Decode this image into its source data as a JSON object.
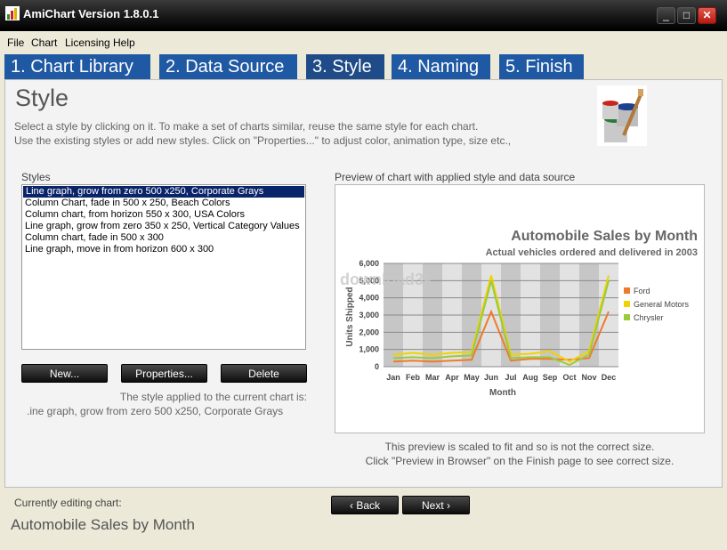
{
  "window": {
    "title": "AmiChart Version 1.8.0.1",
    "minimize": "_",
    "maximize": "□",
    "close": "✕"
  },
  "menu": [
    "File",
    "Chart",
    "Licensing",
    "Help"
  ],
  "tabs": [
    "1. Chart Library",
    "2. Data Source",
    "3. Style",
    "4. Naming",
    "5. Finish"
  ],
  "active_tab": "3. Style",
  "page": {
    "title": "Style",
    "desc1": "Select a style by clicking on it. To make a set of charts similar, reuse the same style for each chart.",
    "desc2": "Use the existing styles or add new styles. Click on \"Properties...\" to adjust color, animation type, size etc.,"
  },
  "styles": {
    "label": "Styles",
    "items": [
      "Line graph, grow from zero 500 x250, Corporate Grays",
      "Column Chart, fade in 500 x 250, Beach Colors",
      "Column chart, from horizon 550 x 300, USA Colors",
      "Line graph, grow from zero 350 x 250, Vertical Category Values",
      "Column chart, fade in 500 x 300",
      "Line graph, move in from horizon 600 x 300"
    ],
    "selected": 0,
    "buttons": {
      "new": "New...",
      "properties": "Properties...",
      "delete": "Delete"
    },
    "applied_label": "The style applied to the current chart is:",
    "applied_value": ".ine graph, grow from zero 500 x250, Corporate Grays"
  },
  "preview": {
    "label": "Preview of chart with applied style and data source",
    "note1": "This preview is scaled to fit and so is not the correct size.",
    "note2": "Click \"Preview in Browser\" on the Finish page to see correct size.",
    "watermark": "download3k"
  },
  "chart_data": {
    "type": "line",
    "title": "Automobile Sales by Month",
    "subtitle": "Actual vehicles ordered and delivered in 2003",
    "xlabel": "Month",
    "ylabel": "Units Shipped",
    "categories": [
      "Jan",
      "Feb",
      "Mar",
      "Apr",
      "May",
      "Jun",
      "Jul",
      "Aug",
      "Sep",
      "Oct",
      "Nov",
      "Dec"
    ],
    "ylim": [
      0,
      6000
    ],
    "yticks": [
      "0",
      "1,000",
      "2,000",
      "3,000",
      "4,000",
      "5,000",
      "6,000"
    ],
    "series": [
      {
        "name": "Ford",
        "color": "#f07a2a",
        "values": [
          300,
          350,
          300,
          350,
          400,
          3200,
          350,
          450,
          450,
          400,
          500,
          3200
        ]
      },
      {
        "name": "General Motors",
        "color": "#f2d200",
        "values": [
          700,
          800,
          700,
          800,
          850,
          5300,
          700,
          750,
          900,
          300,
          900,
          5300
        ]
      },
      {
        "name": "Chrysler",
        "color": "#9acb3c",
        "values": [
          500,
          550,
          500,
          600,
          650,
          5000,
          500,
          550,
          550,
          100,
          700,
          5000
        ]
      }
    ],
    "legend": "right",
    "grid": true
  },
  "footer": {
    "editing_label": "Currently editing chart:",
    "editing_value": "Automobile Sales by Month",
    "back": "‹ Back",
    "next": "Next ›"
  },
  "colors": {
    "tab": "#1f58a3",
    "selection": "#0a246a"
  }
}
